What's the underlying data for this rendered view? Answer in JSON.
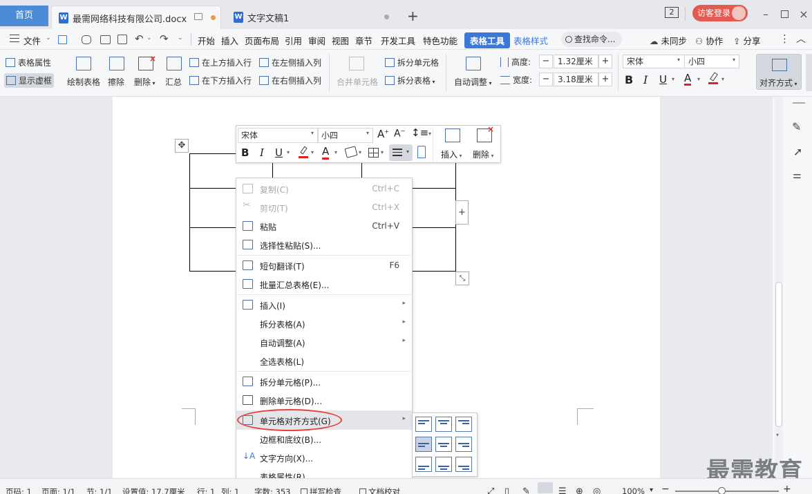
{
  "colors": {
    "accent": "#3b78d8",
    "login": "#e15b50",
    "highlight_circle": "#e8403b"
  },
  "tabs": {
    "home": "首页",
    "doc1": "最需网络科技有限公司.docx",
    "doc2": "文字文稿1",
    "badge": "2",
    "login": "访客登录"
  },
  "menu": {
    "file": "文件",
    "items": [
      "开始",
      "插入",
      "页面布局",
      "引用",
      "审阅",
      "视图",
      "章节",
      "开发工具",
      "特色功能"
    ],
    "table_tools": "表格工具",
    "table_style": "表格样式",
    "search": "查找命令...",
    "unsync": "未同步",
    "collab": "协作",
    "share": "分享"
  },
  "ribbon": {
    "table_props": "表格属性",
    "show_gridlines": "显示虚框",
    "draw_table": "绘制表格",
    "erase": "擦除",
    "delete": "删除",
    "summary": "汇总",
    "insert_above": "在上方插入行",
    "insert_below": "在下方插入行",
    "insert_left": "在左侧插入列",
    "insert_right": "在右侧插入列",
    "merge_cells": "合并单元格",
    "split_cells": "拆分单元格",
    "split_table": "拆分表格",
    "auto_fit": "自动调整",
    "height_label": "高度:",
    "height_value": "1.32厘米",
    "width_label": "宽度:",
    "width_value": "3.18厘米",
    "font": "宋体",
    "size": "小四",
    "align": "对齐方式"
  },
  "mini_toolbar": {
    "font": "宋体",
    "size": "小四",
    "insert": "插入",
    "delete": "删除"
  },
  "context_menu": [
    {
      "label": "复制(C)",
      "shortcut": "Ctrl+C",
      "disabled": true
    },
    {
      "label": "剪切(T)",
      "shortcut": "Ctrl+X",
      "disabled": true
    },
    {
      "label": "粘贴",
      "shortcut": "Ctrl+V"
    },
    {
      "label": "选择性粘贴(S)..."
    },
    {
      "label": "短句翻译(T)",
      "shortcut": "F6"
    },
    {
      "label": "批量汇总表格(E)..."
    },
    {
      "label": "插入(I)",
      "submenu": true
    },
    {
      "label": "拆分表格(A)",
      "submenu": true
    },
    {
      "label": "自动调整(A)",
      "submenu": true
    },
    {
      "label": "全选表格(L)"
    },
    {
      "label": "拆分单元格(P)..."
    },
    {
      "label": "删除单元格(D)..."
    },
    {
      "label": "单元格对齐方式(G)",
      "submenu": true,
      "highlighted": true
    },
    {
      "label": "边框和底纹(B)..."
    },
    {
      "label": "文字方向(X)..."
    },
    {
      "label": "表格属性(R)..."
    }
  ],
  "status": {
    "paragraph": "页码: 1",
    "page": "页面: 1/1",
    "section": "节: 1/1",
    "setting": "设置值: 17.7厘米",
    "row": "行: 1",
    "col": "列: 1",
    "words": "字数: 353",
    "spell": "拼写检查",
    "proof": "文档校对",
    "zoom": "100%"
  },
  "watermark": "最需教育"
}
